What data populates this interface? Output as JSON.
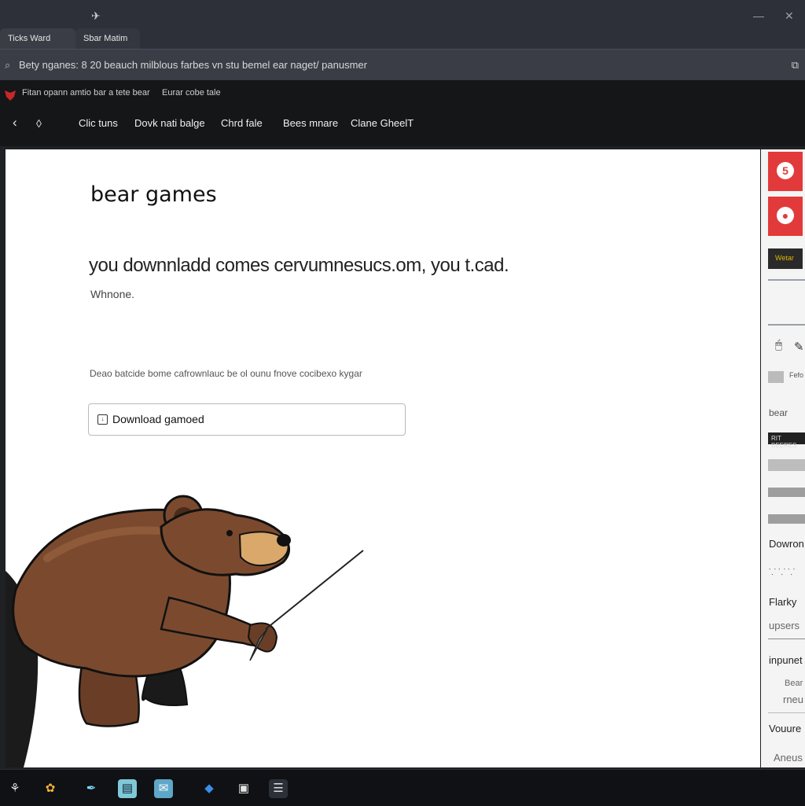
{
  "tabs": [
    {
      "label": "Ticks Ward"
    },
    {
      "label": "Sbar Matim"
    }
  ],
  "address": {
    "text": "Bety nganes:  8  20 beauch milblous farbes vn stu bemel ear naget/  panusmer"
  },
  "site_nav": {
    "small_links": [
      "Fitan opann amtio bar a tete bear",
      "Eurar cobe tale"
    ],
    "links": [
      "Clic tuns",
      "Dovk nati balge",
      "Chrd fale",
      "Bees mnare",
      "Clane GheelT"
    ]
  },
  "main": {
    "title": "bear games",
    "lead": "you downnladd comes cervumnesucs.om, you t.cad.",
    "sub": "Whnone.",
    "description": "Deao batcide bome cafrownlauc be ol ounu fnove cocibexo kygar",
    "download_button": "Download gamoed"
  },
  "sidebar": {
    "card_badge": "5",
    "dark_label": "Wetar",
    "item_a_label": "Fefo",
    "item_b_label": "bear",
    "strip_label": "RIT BEERES",
    "texts": [
      "Dowron",
      "Flarky",
      "upsers",
      "inpunet",
      "Bear",
      "rneu",
      "Vouure",
      "Aneus"
    ]
  },
  "colors": {
    "accent_red": "#e23a3a",
    "nav_bg": "#151618",
    "tab_bg": "#2d3038",
    "bear_fur": "#7b4a2e"
  },
  "icons": {
    "back": "chevron-left-icon",
    "refresh": "drop-icon",
    "download": "download-icon",
    "mouse": "mouse-icon",
    "pen": "pen-icon"
  }
}
